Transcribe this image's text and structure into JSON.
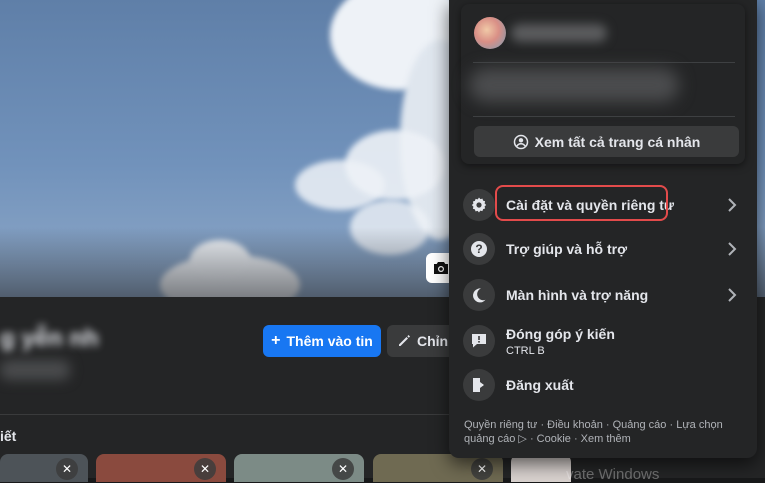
{
  "profile": {
    "add_story_label": "Thêm vào tin",
    "edit_label": "Chỉnh",
    "name_partial": "g yễn nh",
    "section_label": "iết"
  },
  "menu": {
    "see_all_profiles_label": "Xem tất cả trang cá nhân",
    "items": [
      {
        "label": "Cài đặt và quyền riêng tư",
        "icon": "gear-icon"
      },
      {
        "label": "Trợ giúp và hỗ trợ",
        "icon": "help-icon"
      },
      {
        "label": "Màn hình và trợ năng",
        "icon": "moon-icon"
      },
      {
        "label": "Đóng góp ý kiến",
        "sublabel": "CTRL B",
        "icon": "feedback-icon"
      },
      {
        "label": "Đăng xuất",
        "icon": "logout-icon"
      }
    ],
    "footer": "Quyền riêng tư · Điều khoản · Quảng cáo · Lựa chọn quảng cáo ▷ · Cookie · Xem thêm"
  },
  "watermark": "vate Windows",
  "colors": {
    "accent": "#1877f2",
    "highlight": "#e34b4b",
    "background": "#18191a",
    "surface": "#242526"
  }
}
